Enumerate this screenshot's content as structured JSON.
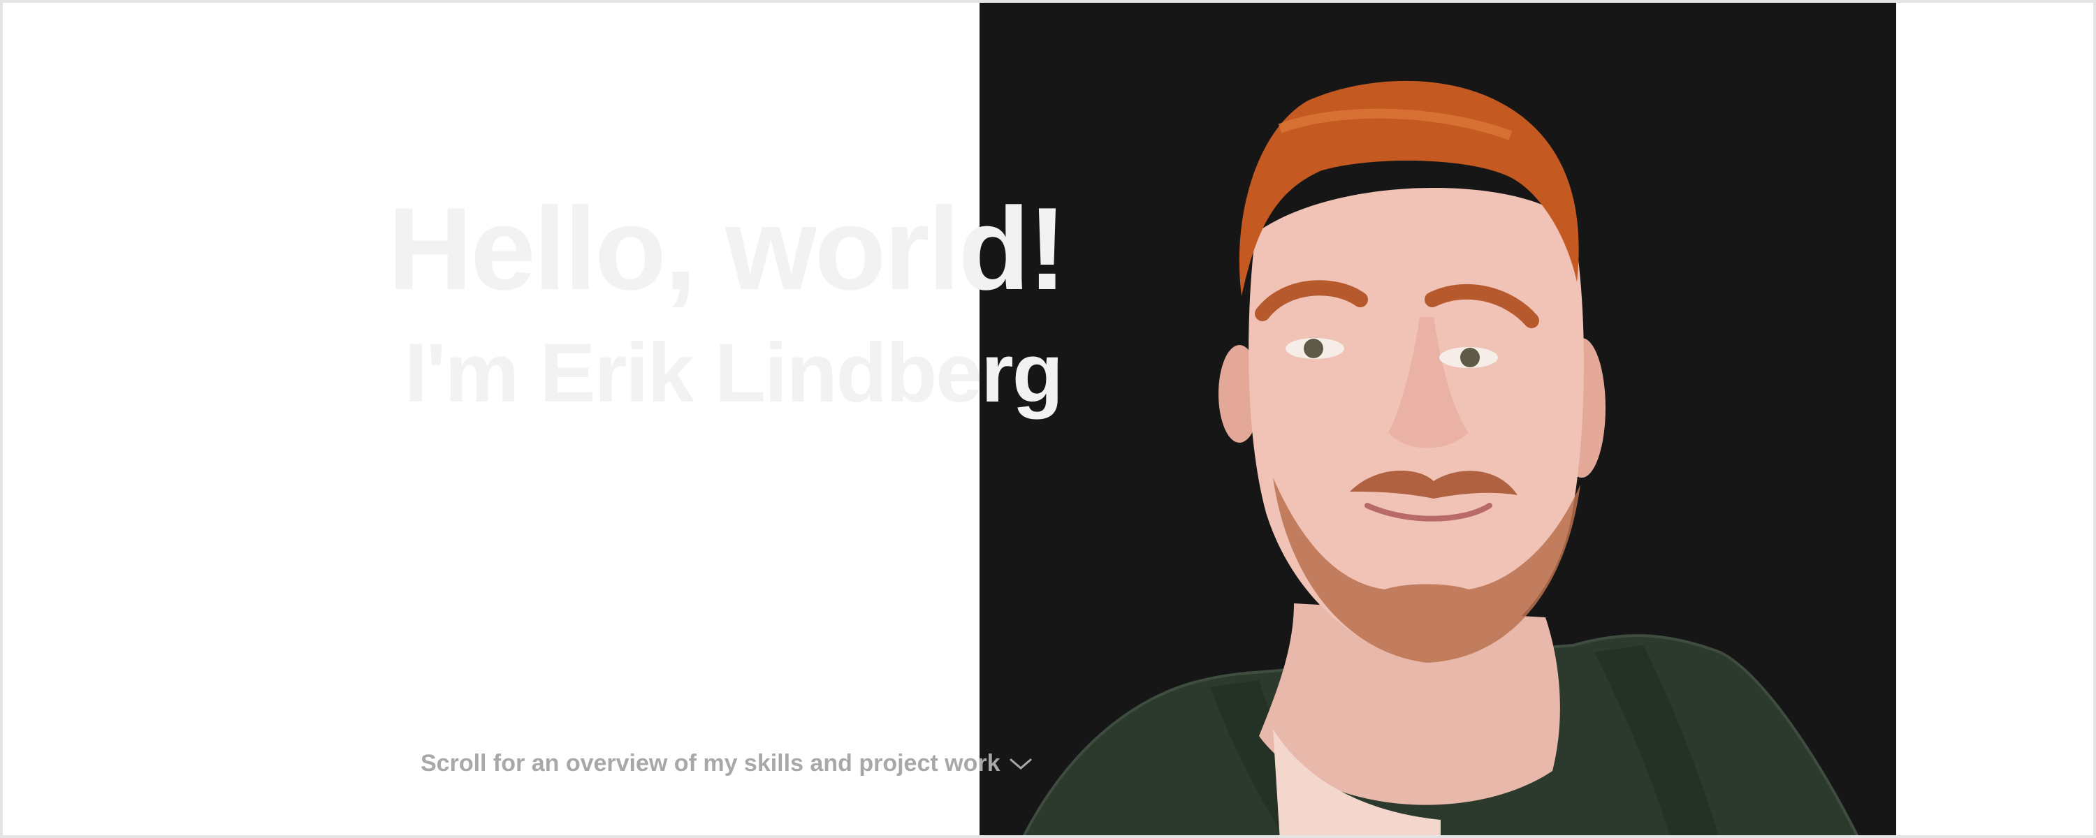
{
  "hero": {
    "greeting": "Hello, world!",
    "name": "I'm Erik Lindberg",
    "scroll_hint": "Scroll for an overview of my skills and project work",
    "scroll_icon": "chevron-down-icon"
  },
  "colors": {
    "panel_background": "#161616",
    "headline_text": "#f2f2f2",
    "hint_text": "#a8a8a8",
    "hair": "#c45a22",
    "hoodie": "#2c3a2e",
    "skin": "#f0c3b6"
  }
}
